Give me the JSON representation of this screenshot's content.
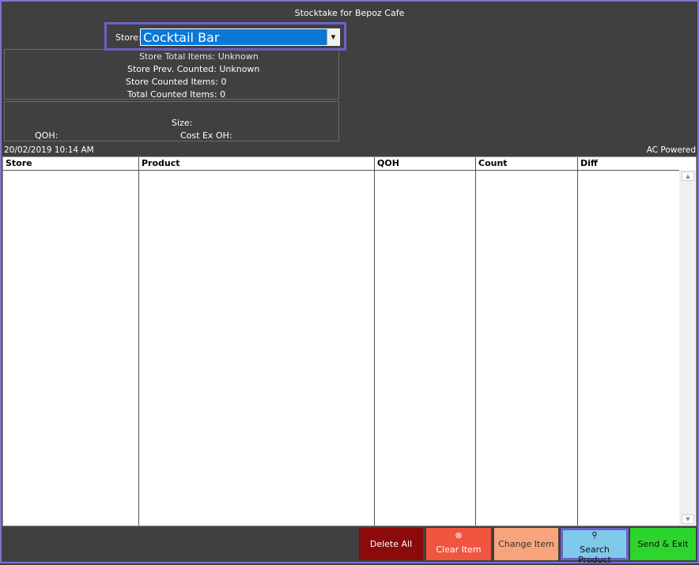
{
  "window": {
    "title": "Stocktake for Bepoz Cafe"
  },
  "store": {
    "label": "Store:",
    "selected": "Cocktail Bar"
  },
  "stats": {
    "total_items": "Store Total Items: Unknown",
    "prev_counted": "Store Prev. Counted: Unknown",
    "store_counted": "Store Counted Items: 0",
    "total_counted": "Total Counted Items: 0"
  },
  "item_info": {
    "size_label": "Size:",
    "qoh_label": "QOH:",
    "cost_label": "Cost Ex OH:"
  },
  "status": {
    "datetime": "20/02/2019 10:14 AM",
    "power": "AC Powered"
  },
  "table": {
    "columns": [
      "Store",
      "Product",
      "QOH",
      "Count",
      "Diff"
    ],
    "rows": []
  },
  "buttons": {
    "delete_all": "Delete All",
    "clear_item": "Clear Item",
    "change_item": "Change Item",
    "search_product": "Search Product",
    "send_exit": "Send & Exit"
  },
  "colors": {
    "background": "#404040",
    "accent_border": "#6a63c9",
    "delete": "#8b0a0a",
    "clear": "#f0553f",
    "change": "#f7a47c",
    "search": "#7fc9ea",
    "send": "#2ed42e"
  }
}
